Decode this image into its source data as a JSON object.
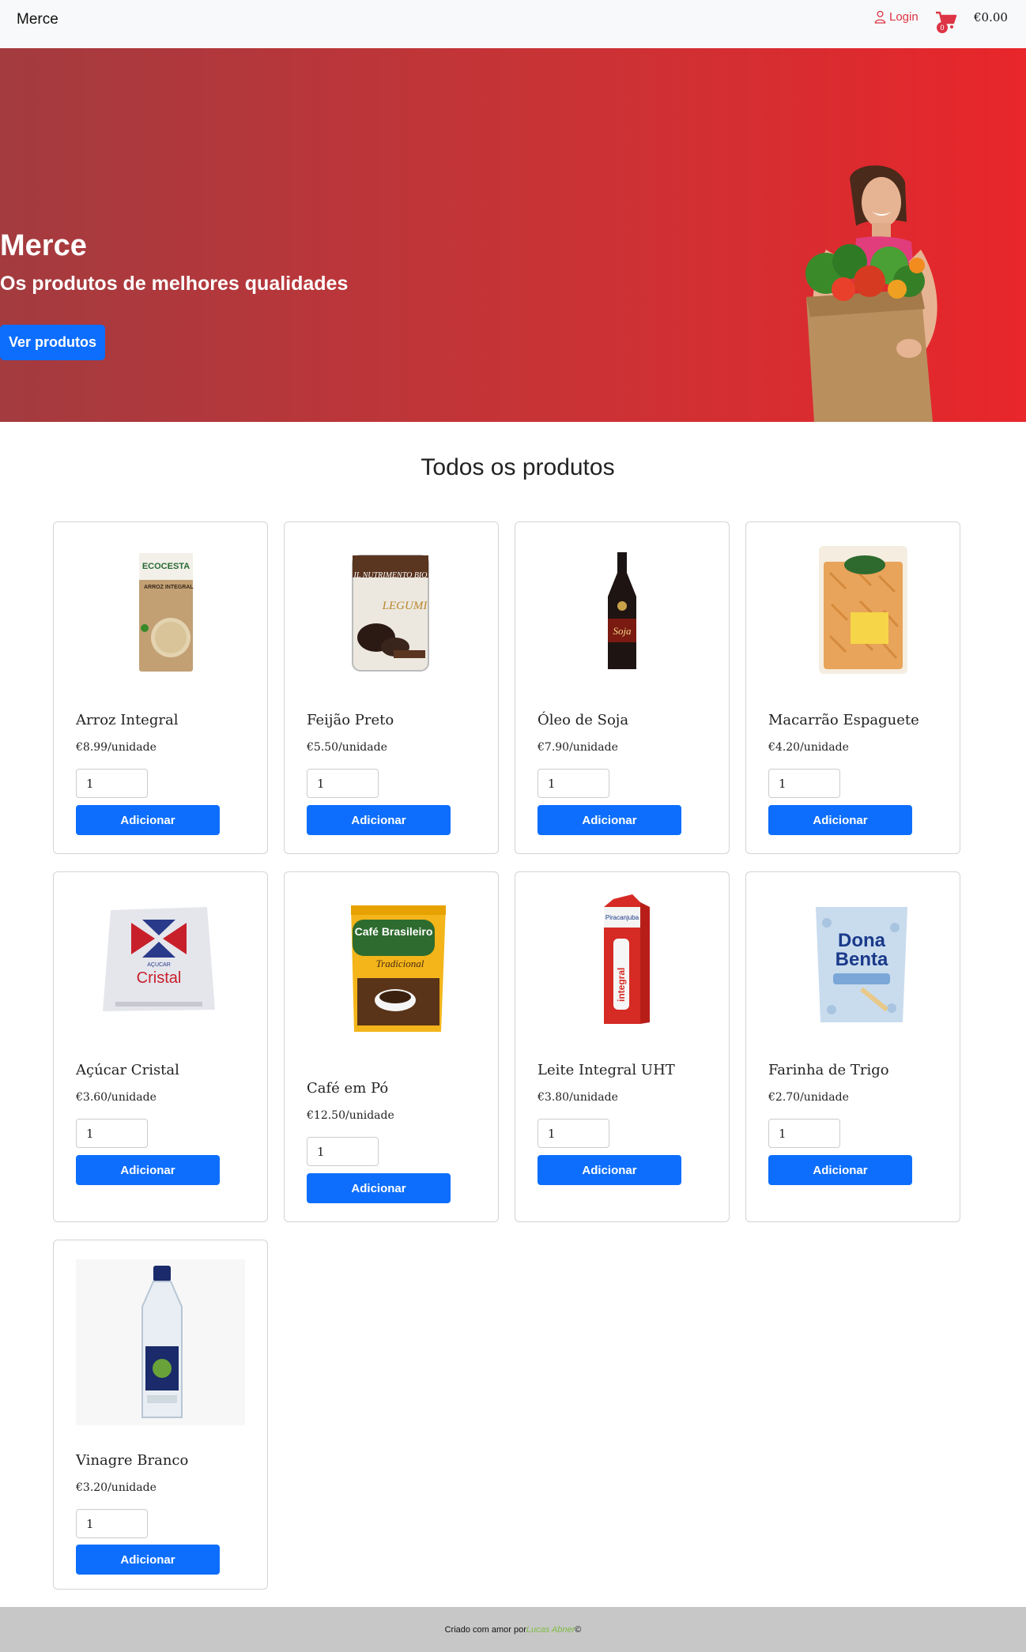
{
  "navbar": {
    "brand": "Merce",
    "login_label": "Login",
    "cart_count": "0",
    "cart_total": "€0.00",
    "icons": [
      "user-icon",
      "cart-icon"
    ],
    "login_color": "#dc3545"
  },
  "hero": {
    "title": "Merce",
    "subtitle": "Os produtos de melhores qualidades",
    "button_label": "Ver produtos",
    "gradient_colors": [
      "#a33b3f",
      "#e8262b"
    ]
  },
  "section_title": "Todos os produtos",
  "products": [
    {
      "name": "Arroz Integral",
      "price": "€8.99/unidade",
      "qty": "1",
      "button": "Adicionar",
      "image": "rice-package-image"
    },
    {
      "name": "Feijão Preto",
      "price": "€5.50/unidade",
      "qty": "1",
      "button": "Adicionar",
      "image": "black-beans-can-image"
    },
    {
      "name": "Óleo de Soja",
      "price": "€7.90/unidade",
      "qty": "1",
      "button": "Adicionar",
      "image": "soy-bottle-image"
    },
    {
      "name": "Macarrão Espaguete",
      "price": "€4.20/unidade",
      "qty": "1",
      "button": "Adicionar",
      "image": "pasta-bag-image"
    },
    {
      "name": "Açúcar Cristal",
      "price": "€3.60/unidade",
      "qty": "1",
      "button": "Adicionar",
      "image": "sugar-bag-image"
    },
    {
      "name": "Café em Pó",
      "price": "€12.50/unidade",
      "qty": "1",
      "button": "Adicionar",
      "image": "coffee-package-image"
    },
    {
      "name": "Leite Integral UHT",
      "price": "€3.80/unidade",
      "qty": "1",
      "button": "Adicionar",
      "image": "milk-carton-image"
    },
    {
      "name": "Farinha de Trigo",
      "price": "€2.70/unidade",
      "qty": "1",
      "button": "Adicionar",
      "image": "flour-bag-image"
    },
    {
      "name": "Vinagre Branco",
      "price": "€3.20/unidade",
      "qty": "1",
      "button": "Adicionar",
      "image": "vinegar-bottle-image"
    }
  ],
  "product_images": {
    "rice_brand": "ECOCESTA",
    "rice_label": "ARROZ INTEGRAL",
    "beans_brand": "IL NUTRIMENTO BIO",
    "beans_label": "LEGUMI",
    "soy_label": "Soja",
    "sugar_brand": "AÇUCAR",
    "sugar_label": "Cristal",
    "coffee_brand": "Café Brasileiro",
    "coffee_label": "Tradicional",
    "milk_brand": "Piracanjuba",
    "milk_label": "integral",
    "flour_brand": "Dona",
    "flour_label": "Benta"
  },
  "footer": {
    "prefix": "Criado com amor por ",
    "author": "Lucas Abner",
    "suffix": "©"
  },
  "button_color": "#0d6efd"
}
